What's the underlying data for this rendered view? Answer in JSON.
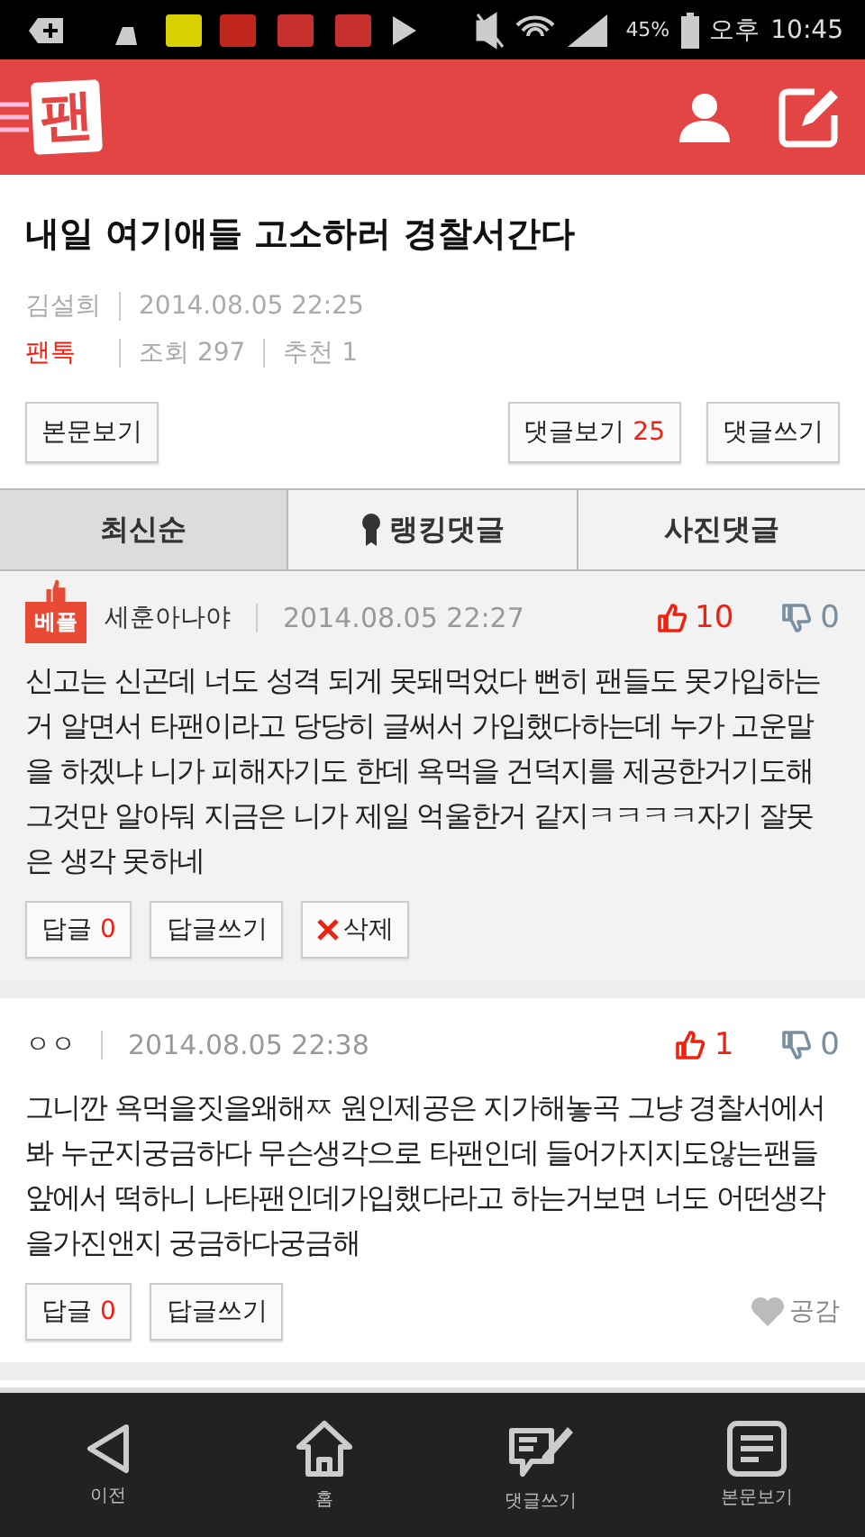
{
  "status_bar": {
    "battery": "45%",
    "ampm": "오후",
    "time": "10:45"
  },
  "header": {
    "logo": "팬"
  },
  "article": {
    "title": "내일 여기애들 고소하러 경찰서간다",
    "author": "김설희",
    "date": "2014.08.05 22:25",
    "category": "팬톡",
    "views_label": "조회",
    "views": "297",
    "recommend_label": "추천",
    "recommend": "1",
    "view_body_button": "본문보기",
    "view_comments_button": "댓글보기",
    "comment_count": "25",
    "write_comment_button": "댓글쓰기"
  },
  "tabs": [
    {
      "label": "최신순",
      "selected": true,
      "kind": "plain"
    },
    {
      "label": "랭킹댓글",
      "selected": false,
      "kind": "ranking"
    },
    {
      "label": "사진댓글",
      "selected": false,
      "kind": "plain"
    }
  ],
  "comments": [
    {
      "best": true,
      "badge": "베플",
      "author": "세훈아나야",
      "date": "2014.08.05 22:27",
      "likes": "10",
      "dislikes": "0",
      "body": "신고는 신곤데 너도 성격 되게 못돼먹었다 뻔히 팬들도 못가입하는거 알면서 타팬이라고 당당히 글써서 가입했다하는데 누가 고운말을 하겠냐 니가 피해자기도 한데 욕먹을 건덕지를 제공한거기도해 그것만 알아둬 지금은 니가 제일 억울한거 같지ㅋㅋㅋㅋ자기 잘못은 생각 못하네",
      "reply_label": "답글",
      "reply_count": "0",
      "reply_write": "답글쓰기",
      "extra": {
        "kind": "delete",
        "label": "삭제"
      }
    },
    {
      "best": false,
      "author": "ㅇㅇ",
      "date": "2014.08.05 22:38",
      "likes": "1",
      "dislikes": "0",
      "body": "그니깐 욕먹을짓을왜해ㅉ 원인제공은 지가해놓곡 그냥 경찰서에서 봐 누군지궁금하다 무슨생각으로 타팬인데 들어가지지도않는팬들 앞에서 떡하니 나타팬인데가입했다라고 하는거보면 너도 어떤생각을가진앤지 궁금하다궁금해",
      "reply_label": "답글",
      "reply_count": "0",
      "reply_write": "답글쓰기",
      "extra": {
        "kind": "like",
        "label": "공감"
      }
    }
  ],
  "bottom_nav": [
    {
      "kind": "back",
      "label": "이전"
    },
    {
      "kind": "home",
      "label": "홈"
    },
    {
      "kind": "write",
      "label": "댓글쓰기"
    },
    {
      "kind": "article",
      "label": "본문보기"
    }
  ]
}
